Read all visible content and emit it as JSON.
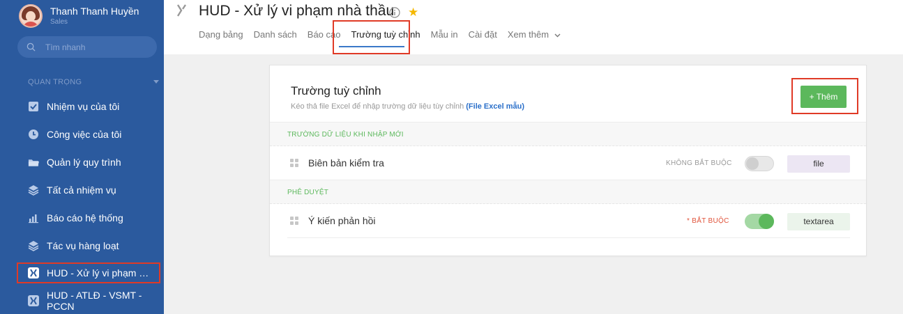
{
  "profile": {
    "name": "Thanh Thanh Huyền",
    "role": "Sales"
  },
  "search": {
    "placeholder": "Tìm nhanh"
  },
  "sidebar": {
    "section_title": "QUAN TRỌNG",
    "items": [
      {
        "label": "Nhiệm vụ của tôi",
        "icon": "check-square-icon"
      },
      {
        "label": "Công việc của tôi",
        "icon": "clock-icon"
      },
      {
        "label": "Quản lý quy trình",
        "icon": "folder-icon"
      },
      {
        "label": "Tất cả nhiệm vụ",
        "icon": "layers-icon"
      },
      {
        "label": "Báo cáo hệ thống",
        "icon": "bar-chart-icon"
      },
      {
        "label": "Tác vụ hàng loạt",
        "icon": "layers-icon"
      },
      {
        "label": "HUD - Xử lý vi phạm nh...",
        "icon": "app-logo-icon",
        "active": true
      },
      {
        "label": "HUD - ATLĐ - VSMT - PCCN",
        "icon": "app-logo-icon"
      }
    ]
  },
  "header": {
    "title": "HUD - Xử lý vi phạm nhà thầu",
    "tabs": [
      {
        "label": "Dạng bảng"
      },
      {
        "label": "Danh sách"
      },
      {
        "label": "Báo cáo"
      },
      {
        "label": "Trường tuỳ chỉnh",
        "active": true
      },
      {
        "label": "Mẫu in"
      },
      {
        "label": "Cài đặt"
      },
      {
        "label": "Xem thêm"
      }
    ]
  },
  "card": {
    "title": "Trường tuỳ chỉnh",
    "desc": "Kéo thả file Excel để nhập trường dữ liệu tùy chỉnh",
    "desc_link": "(File Excel mẫu)",
    "add_button": "+ Thêm",
    "groups": [
      {
        "title": "TRƯỜNG DỮ LIỆU KHI NHẬP MỚI",
        "fields": [
          {
            "label": "Biên bản kiểm tra",
            "requirement": "KHÔNG BẮT BUỘC",
            "required": false,
            "type": "file"
          }
        ]
      },
      {
        "title": "PHÊ DUYỆT",
        "fields": [
          {
            "label": "Ý kiến phản hồi",
            "requirement": "* BẮT BUỘC",
            "required": true,
            "type": "textarea"
          }
        ]
      }
    ]
  },
  "colors": {
    "sidebar_bg": "#2b5a9e",
    "accent_green": "#5cb85c",
    "highlight_red": "#e03a26",
    "link_blue": "#2a6fc9",
    "star": "#f5b800"
  }
}
